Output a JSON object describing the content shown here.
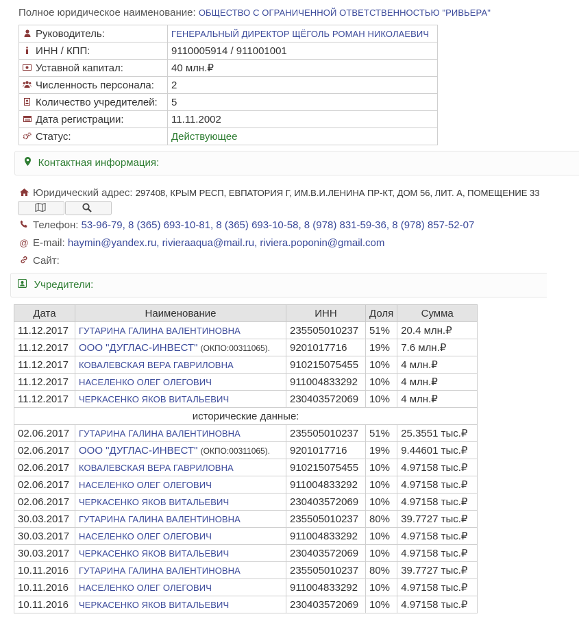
{
  "header": {
    "full_name_label": "Полное юридическое наименование:",
    "full_name_value": "ОБЩЕСТВО С ОГРАНИЧЕННОЙ ОТВЕТСТВЕННОСТЬЮ \"РИВЬЕРА\""
  },
  "info": [
    {
      "icon": "person-icon",
      "label": "Руководитель:",
      "value": "ГЕНЕРАЛЬНЫЙ ДИРЕКТОР ЩЁГОЛЬ РОМАН НИКОЛАЕВИЧ",
      "link": true,
      "caps": true
    },
    {
      "icon": "info-icon",
      "label": "ИНН / КПП:",
      "value": "9110005914 / 911001001"
    },
    {
      "icon": "money-icon",
      "label": "Уставной капитал:",
      "value": "40 млн.₽"
    },
    {
      "icon": "users-icon",
      "label": "Численность персонала:",
      "value": "2"
    },
    {
      "icon": "founder-card-icon",
      "label": "Количество учредителей:",
      "value": "5"
    },
    {
      "icon": "calendar-icon",
      "label": "Дата регистрации:",
      "value": "11.11.2002"
    },
    {
      "icon": "gears-icon",
      "label": "Статус:",
      "value": "Действующее",
      "status": true
    }
  ],
  "contacts": {
    "title": "Контактная информация:",
    "address_label": "Юридический адрес:",
    "address_value": "297408, КРЫМ РЕСП, ЕВПАТОРИЯ Г, ИМ.В.И.ЛЕНИНА ПР-КТ, ДОМ 56, ЛИТ. А, ПОМЕЩЕНИЕ 33",
    "phone_label": "Телефон:",
    "phone_value": "53-96-79, 8 (365) 693-10-81, 8 (365) 693-10-58, 8 (978) 831-59-36, 8 (978) 857-52-07",
    "email_label": "E-mail:",
    "email_value": "haymin@yandex.ru, rivieraaqua@mail.ru, riviera.poponin@gmail.com",
    "site_label": "Сайт:"
  },
  "founders": {
    "title": "Учредители:",
    "headers": {
      "date": "Дата",
      "name": "Наименование",
      "inn": "ИНН",
      "share": "Доля",
      "sum": "Сумма"
    },
    "historical_label": "исторические данные:",
    "current": [
      {
        "date": "11.12.2017",
        "name": "ГУТАРИНА ГАЛИНА ВАЛЕНТИНОВНА",
        "inn": "235505010237",
        "share": "51%",
        "sum": "20.4 млн.₽"
      },
      {
        "date": "11.12.2017",
        "name": "ООО \"ДУГЛАС-ИНВЕСТ\"",
        "okpo": "(ОКПО:00311065).",
        "inn": "9201017716",
        "share": "19%",
        "sum": "7.6 млн.₽"
      },
      {
        "date": "11.12.2017",
        "name": "КОВАЛЕВСКАЯ ВЕРА ГАВРИЛОВНА",
        "inn": "910215075455",
        "share": "10%",
        "sum": "4 млн.₽"
      },
      {
        "date": "11.12.2017",
        "name": "НАСЕЛЕНКО ОЛЕГ ОЛЕГОВИЧ",
        "inn": "911004833292",
        "share": "10%",
        "sum": "4 млн.₽"
      },
      {
        "date": "11.12.2017",
        "name": "ЧЕРКАСЕНКО ЯКОВ ВИТАЛЬЕВИЧ",
        "inn": "230403572069",
        "share": "10%",
        "sum": "4 млн.₽"
      }
    ],
    "historical": [
      {
        "date": "02.06.2017",
        "name": "ГУТАРИНА ГАЛИНА ВАЛЕНТИНОВНА",
        "inn": "235505010237",
        "share": "51%",
        "sum": "25.3551 тыс.₽"
      },
      {
        "date": "02.06.2017",
        "name": "ООО \"ДУГЛАС-ИНВЕСТ\"",
        "okpo": "(ОКПО:00311065).",
        "inn": "9201017716",
        "share": "19%",
        "sum": "9.44601 тыс.₽"
      },
      {
        "date": "02.06.2017",
        "name": "КОВАЛЕВСКАЯ ВЕРА ГАВРИЛОВНА",
        "inn": "910215075455",
        "share": "10%",
        "sum": "4.97158 тыс.₽"
      },
      {
        "date": "02.06.2017",
        "name": "НАСЕЛЕНКО ОЛЕГ ОЛЕГОВИЧ",
        "inn": "911004833292",
        "share": "10%",
        "sum": "4.97158 тыс.₽"
      },
      {
        "date": "02.06.2017",
        "name": "ЧЕРКАСЕНКО ЯКОВ ВИТАЛЬЕВИЧ",
        "inn": "230403572069",
        "share": "10%",
        "sum": "4.97158 тыс.₽"
      },
      {
        "date": "30.03.2017",
        "name": "ГУТАРИНА ГАЛИНА ВАЛЕНТИНОВНА",
        "inn": "235505010237",
        "share": "80%",
        "sum": "39.7727 тыс.₽"
      },
      {
        "date": "30.03.2017",
        "name": "НАСЕЛЕНКО ОЛЕГ ОЛЕГОВИЧ",
        "inn": "911004833292",
        "share": "10%",
        "sum": "4.97158 тыс.₽"
      },
      {
        "date": "30.03.2017",
        "name": "ЧЕРКАСЕНКО ЯКОВ ВИТАЛЬЕВИЧ",
        "inn": "230403572069",
        "share": "10%",
        "sum": "4.97158 тыс.₽"
      },
      {
        "date": "10.11.2016",
        "name": "ГУТАРИНА ГАЛИНА ВАЛЕНТИНОВНА",
        "inn": "235505010237",
        "share": "80%",
        "sum": "39.7727 тыс.₽"
      },
      {
        "date": "10.11.2016",
        "name": "НАСЕЛЕНКО ОЛЕГ ОЛЕГОВИЧ",
        "inn": "911004833292",
        "share": "10%",
        "sum": "4.97158 тыс.₽"
      },
      {
        "date": "10.11.2016",
        "name": "ЧЕРКАСЕНКО ЯКОВ ВИТАЛЬЕВИЧ",
        "inn": "230403572069",
        "share": "10%",
        "sum": "4.97158 тыс.₽"
      }
    ]
  },
  "colors": {
    "link": "#3b4a9a",
    "accent": "#2e7d32",
    "icon": "#8b3a3a"
  }
}
